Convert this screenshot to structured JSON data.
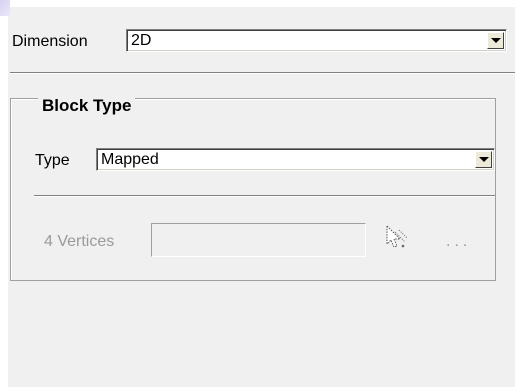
{
  "dimension": {
    "label": "Dimension",
    "value": "2D"
  },
  "block_type": {
    "title": "Block Type",
    "type_label": "Type",
    "type_value": "Mapped",
    "vertices_label": "4 Vertices",
    "vertices_value": "",
    "ellipsis": "..."
  },
  "icons": {
    "picker": "pointer-select-icon",
    "dropdown": "chevron-down-icon"
  },
  "colors": {
    "panel_bg": "#f0f0f0",
    "disabled_text": "#9a9a9a"
  }
}
